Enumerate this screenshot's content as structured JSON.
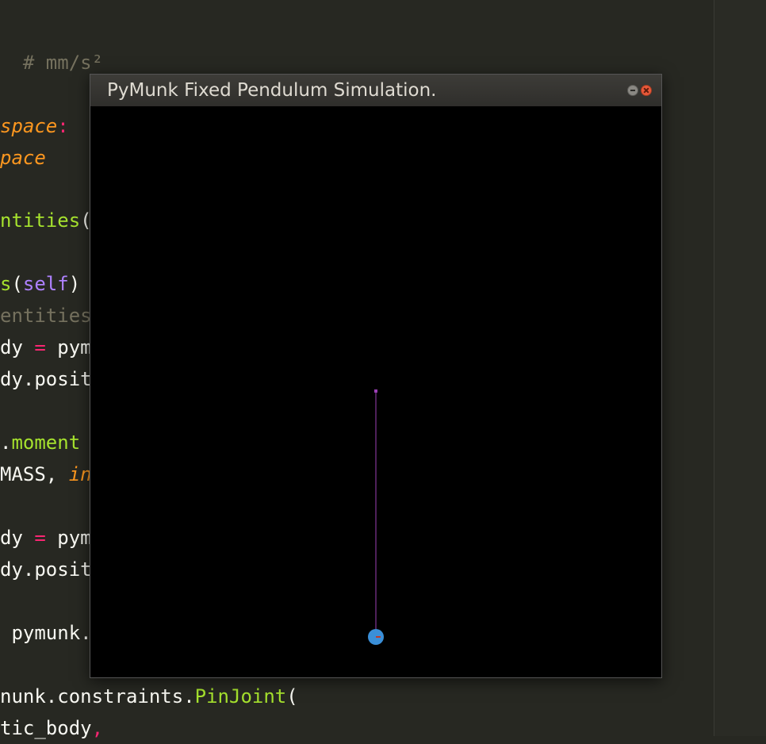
{
  "editor": {
    "lines": [
      {
        "segments": [
          {
            "text": "  # mm/s²",
            "class": "c-comment"
          }
        ]
      },
      {
        "segments": [
          {
            "text": "space",
            "class": "c-orange"
          },
          {
            "text": ":",
            "class": "c-pink"
          }
        ]
      },
      {
        "segments": [
          {
            "text": "pace",
            "class": "c-orange"
          }
        ]
      },
      {
        "segments": [
          {
            "text": "ntities",
            "class": "c-green"
          },
          {
            "text": "(",
            "class": "c-plain"
          }
        ]
      },
      {
        "segments": [
          {
            "text": "s",
            "class": "c-green"
          },
          {
            "text": "(",
            "class": "c-plain"
          },
          {
            "text": "self",
            "class": "c-purple"
          },
          {
            "text": ")",
            "class": "c-plain"
          }
        ]
      },
      {
        "segments": [
          {
            "text": "entities",
            "class": "c-dim"
          }
        ]
      },
      {
        "segments": [
          {
            "text": "dy ",
            "class": "c-plain"
          },
          {
            "text": "=",
            "class": "c-pink"
          },
          {
            "text": " pym",
            "class": "c-plain"
          }
        ]
      },
      {
        "segments": [
          {
            "text": "dy.posit",
            "class": "c-plain"
          }
        ]
      },
      {
        "segments": [
          {
            "text": ".",
            "class": "c-plain"
          },
          {
            "text": "moment",
            "class": "c-green"
          }
        ]
      },
      {
        "segments": [
          {
            "text": "MASS",
            "class": "c-plain"
          },
          {
            "text": ", ",
            "class": "c-plain"
          },
          {
            "text": "in",
            "class": "c-red"
          }
        ]
      },
      {
        "segments": [
          {
            "text": "dy ",
            "class": "c-plain"
          },
          {
            "text": "=",
            "class": "c-pink"
          },
          {
            "text": " pym",
            "class": "c-plain"
          }
        ]
      },
      {
        "segments": [
          {
            "text": "dy.posit",
            "class": "c-plain"
          }
        ]
      },
      {
        "segments": [
          {
            "text": " pymunk.",
            "class": "c-plain"
          }
        ]
      },
      {
        "segments": [
          {
            "text": "nunk.constraints.",
            "class": "c-plain"
          },
          {
            "text": "PinJoint",
            "class": "c-green"
          },
          {
            "text": "(",
            "class": "c-plain"
          }
        ]
      },
      {
        "segments": [
          {
            "text": "tic_body",
            "class": "c-plain"
          },
          {
            "text": ",",
            "class": "c-pink"
          }
        ]
      }
    ]
  },
  "window": {
    "title": "PyMunk Fixed Pendulum Simulation."
  },
  "simulation": {
    "pivot_color": "#9b3fb5",
    "string_color": "#9b3fb5",
    "bob_color": "#3a8fd8",
    "bob_marker_color": "#c0392b",
    "background_color": "#000000"
  }
}
